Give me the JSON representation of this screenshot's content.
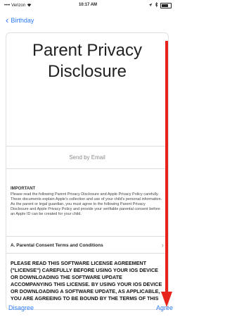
{
  "status_bar": {
    "carrier": "•••• Verizon",
    "time": "10:17 AM",
    "signal_icon": "signal-dots-icon",
    "wifi_icon": "wifi-icon",
    "battery_icon": "battery-icon"
  },
  "nav": {
    "back_label": "Birthday",
    "back_icon": "chevron-left-icon"
  },
  "content": {
    "title_line1": "Parent Privacy",
    "title_line2": "Disclosure",
    "send_by_email": "Send by Email",
    "important_heading": "IMPORTANT",
    "important_text": "Please read the following Parent Privacy Disclosure and Apple Privacy Policy carefully. These documents explain Apple's collection and use of your child's personal information. As the parent or legal guardian, you must agree to the following Parent Privacy Disclosure and Apple Privacy Policy and provide your verifiable parental consent before an Apple ID can be created for your child.",
    "consent_row_label": "A. Parental Consent Terms and Conditions",
    "license_text": "PLEASE READ THIS SOFTWARE LICENSE AGREEMENT (\"LICENSE\") CAREFULLY BEFORE USING YOUR IOS DEVICE OR DOWNLOADING THE SOFTWARE UPDATE ACCOMPANYING THIS LICENSE. BY USING YOUR IOS DEVICE OR DOWNLOADING A SOFTWARE UPDATE, AS APPLICABLE, YOU ARE AGREEING TO BE BOUND BY THE TERMS OF THIS"
  },
  "toolbar": {
    "disagree_label": "Disagree",
    "agree_label": "Agree"
  },
  "colors": {
    "accent": "#2f7cf6",
    "annotation_arrow": "#e8231b"
  }
}
